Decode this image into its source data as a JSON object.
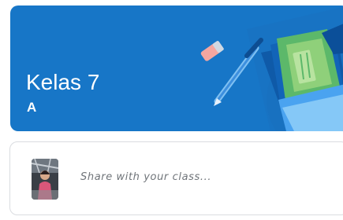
{
  "banner": {
    "class_title": "Kelas 7",
    "class_section": "A",
    "theme_color": "#1776c7",
    "illustration_icons": [
      "eraser-icon",
      "pen-icon",
      "book-icon"
    ]
  },
  "share_box": {
    "placeholder": "Share with your class...",
    "avatar_icon": "user-avatar"
  }
}
